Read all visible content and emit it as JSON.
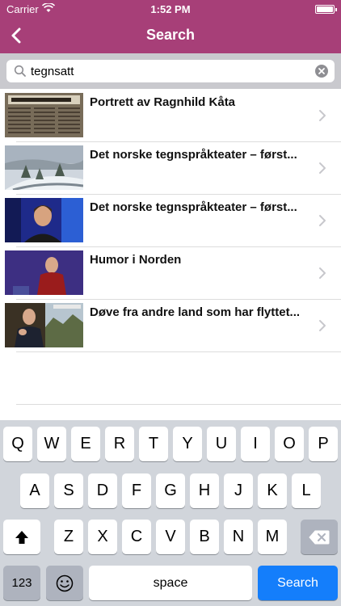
{
  "status_bar": {
    "carrier": "Carrier",
    "time": "1:52 PM"
  },
  "nav": {
    "title": "Search",
    "back_icon": "chevron-left-icon"
  },
  "search": {
    "value": "tegnsatt",
    "search_icon": "search-icon",
    "clear_icon": "clear-icon"
  },
  "results": [
    {
      "title": "Portrett av Ragnhild Kåta",
      "thumb": "newspaper-clipping"
    },
    {
      "title": "Det norske tegnspråkteater – først...",
      "thumb": "snowy-landscape"
    },
    {
      "title": "Det norske tegnspråkteater – først...",
      "thumb": "woman-on-stage"
    },
    {
      "title": "Humor i Norden",
      "thumb": "man-on-stage"
    },
    {
      "title": "Døve fra andre land som har flyttet...",
      "thumb": "man-signing"
    }
  ],
  "keyboard": {
    "row1": [
      "Q",
      "W",
      "E",
      "R",
      "T",
      "Y",
      "U",
      "I",
      "O",
      "P"
    ],
    "row2": [
      "A",
      "S",
      "D",
      "F",
      "G",
      "H",
      "J",
      "K",
      "L"
    ],
    "row3": [
      "Z",
      "X",
      "C",
      "V",
      "B",
      "N",
      "M"
    ],
    "numbers_label": "123",
    "space_label": "space",
    "search_label": "Search",
    "shift_icon": "shift-icon",
    "delete_icon": "backspace-icon",
    "emoji_icon": "emoji-icon"
  },
  "colors": {
    "nav_bar": "#a73f78",
    "search_key": "#147efb"
  }
}
